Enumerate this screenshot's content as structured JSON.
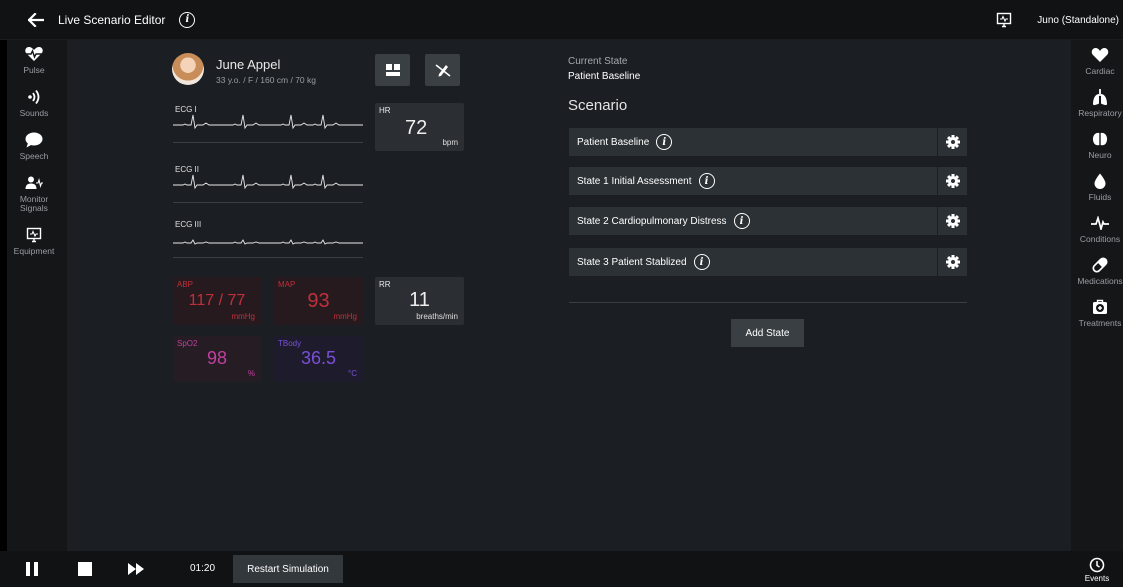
{
  "header": {
    "title": "Live Scenario Editor",
    "device": "Juno (Standalone)"
  },
  "left_sidebar": [
    {
      "label": "Pulse",
      "icon": "heart-pulse-icon"
    },
    {
      "label": "Sounds",
      "icon": "sound-waves-icon"
    },
    {
      "label": "Speech",
      "icon": "speech-bubble-icon"
    },
    {
      "label": "Monitor\nSignals",
      "icon": "person-signal-icon"
    },
    {
      "label": "Equipment",
      "icon": "monitor-icon"
    }
  ],
  "right_sidebar": [
    {
      "label": "Cardiac",
      "icon": "heart-icon"
    },
    {
      "label": "Respiratory",
      "icon": "lungs-icon"
    },
    {
      "label": "Neuro",
      "icon": "brain-icon"
    },
    {
      "label": "Fluids",
      "icon": "drop-icon"
    },
    {
      "label": "Conditions",
      "icon": "ecg-icon"
    },
    {
      "label": "Medications",
      "icon": "pill-icon"
    },
    {
      "label": "Treatments",
      "icon": "medkit-icon"
    }
  ],
  "patient": {
    "name": "June Appel",
    "info": "33 y.o. / F / 160 cm / 70 kg"
  },
  "ecg": [
    "ECG I",
    "ECG II",
    "ECG III"
  ],
  "vitals": {
    "hr": {
      "label": "HR",
      "value": "72",
      "unit": "bpm"
    },
    "abp": {
      "label": "ABP",
      "value": "117 / 77",
      "unit": "mmHg"
    },
    "map": {
      "label": "MAP",
      "value": "93",
      "unit": "mmHg"
    },
    "rr": {
      "label": "RR",
      "value": "11",
      "unit": "breaths/min"
    },
    "spo2": {
      "label": "SpO2",
      "value": "98",
      "unit": "%"
    },
    "tbody": {
      "label": "TBody",
      "value": "36.5",
      "unit": "°C"
    }
  },
  "scenario": {
    "current_state_label": "Current State",
    "current_state": "Patient Baseline",
    "title": "Scenario",
    "states": [
      "Patient Baseline",
      "State 1 Initial Assessment",
      "State 2 Cardiopulmonary Distress",
      "State 3 Patient Stablized"
    ],
    "add_state": "Add State"
  },
  "footer": {
    "time": "01:20",
    "restart": "Restart Simulation",
    "events": "Events"
  },
  "colors": {
    "abp": "#c0303a",
    "map": "#c0303a",
    "spo2": "#c23fa0",
    "tbody": "#7a4fd6",
    "background": "#1b1f23"
  }
}
